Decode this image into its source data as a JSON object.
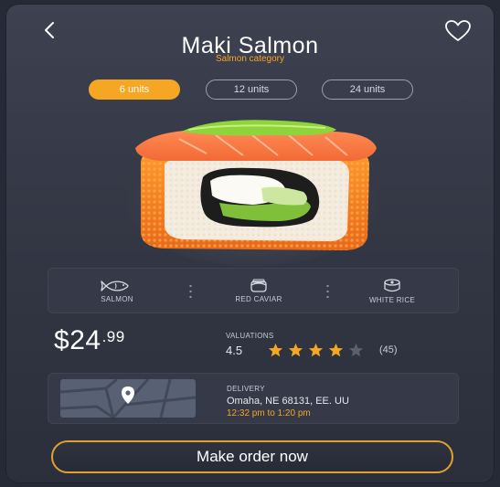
{
  "product": {
    "name": "Maki Salmon",
    "category": "Salmon category"
  },
  "icons": {
    "back": "chevron-left-icon",
    "favorite": "heart-outline-icon"
  },
  "units": [
    {
      "label": "6 units",
      "selected": true
    },
    {
      "label": "12 units",
      "selected": false
    },
    {
      "label": "24 units",
      "selected": false
    }
  ],
  "ingredients": [
    {
      "label": "SALMON",
      "icon": "fish-icon"
    },
    {
      "label": "RED CAVIAR",
      "icon": "caviar-jar-icon"
    },
    {
      "label": "WHITE RICE",
      "icon": "rice-bowl-icon"
    }
  ],
  "price": {
    "currency": "$",
    "whole": "24",
    "cents": "99"
  },
  "valuations": {
    "label": "VALUATIONS",
    "score": "4.5",
    "stars_filled": 4,
    "stars_total": 5,
    "count": "(45)"
  },
  "delivery": {
    "label": "DELIVERY",
    "address": "Omaha, NE 68131, EE. UU",
    "time": "12:32 pm to 1:20 pm"
  },
  "cta": {
    "label": "Make order now"
  },
  "colors": {
    "accent": "#f5a623",
    "star_empty": "#5c606c"
  }
}
